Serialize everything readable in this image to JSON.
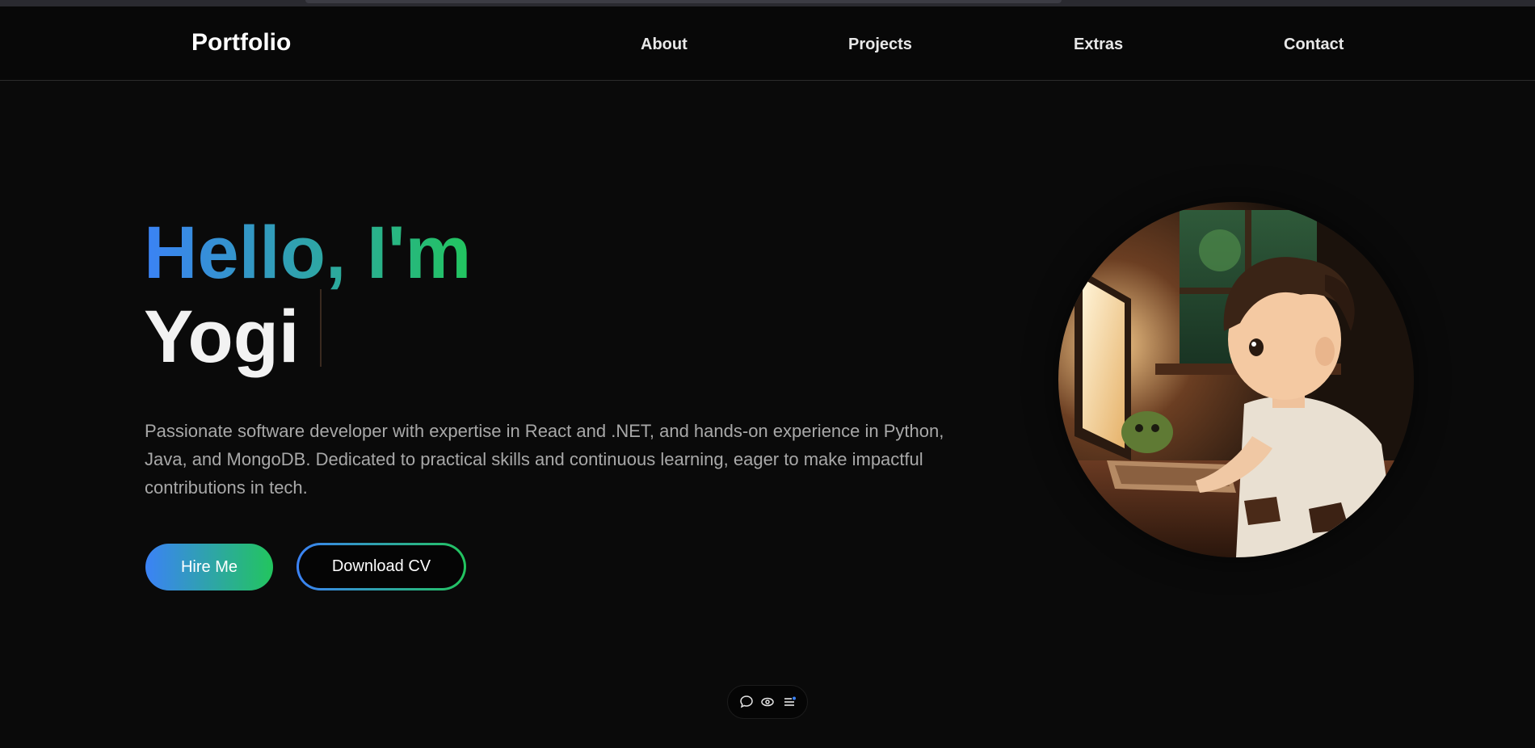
{
  "navbar": {
    "brand": "Portfolio",
    "links": [
      "About",
      "Projects",
      "Extras",
      "Contact"
    ]
  },
  "hero": {
    "greeting": "Hello, I'm",
    "name": "Yogi",
    "bio": "Passionate software developer with expertise in React and .NET, and hands-on experience in Python, Java, and MongoDB. Dedicated to practical skills and continuous learning, eager to make impactful contributions in tech.",
    "hire_label": "Hire Me",
    "cv_label": "Download CV",
    "avatar_alt": "illustrated boy typing at a computer"
  },
  "toolbar": {
    "icons": [
      "chat-bubble-icon",
      "eye-icon",
      "menu-list-icon"
    ]
  },
  "colors": {
    "background": "#0a0a0a",
    "gradient_start": "#3b82f6",
    "gradient_end": "#22c55e",
    "bio_text": "#a8a8a8"
  }
}
